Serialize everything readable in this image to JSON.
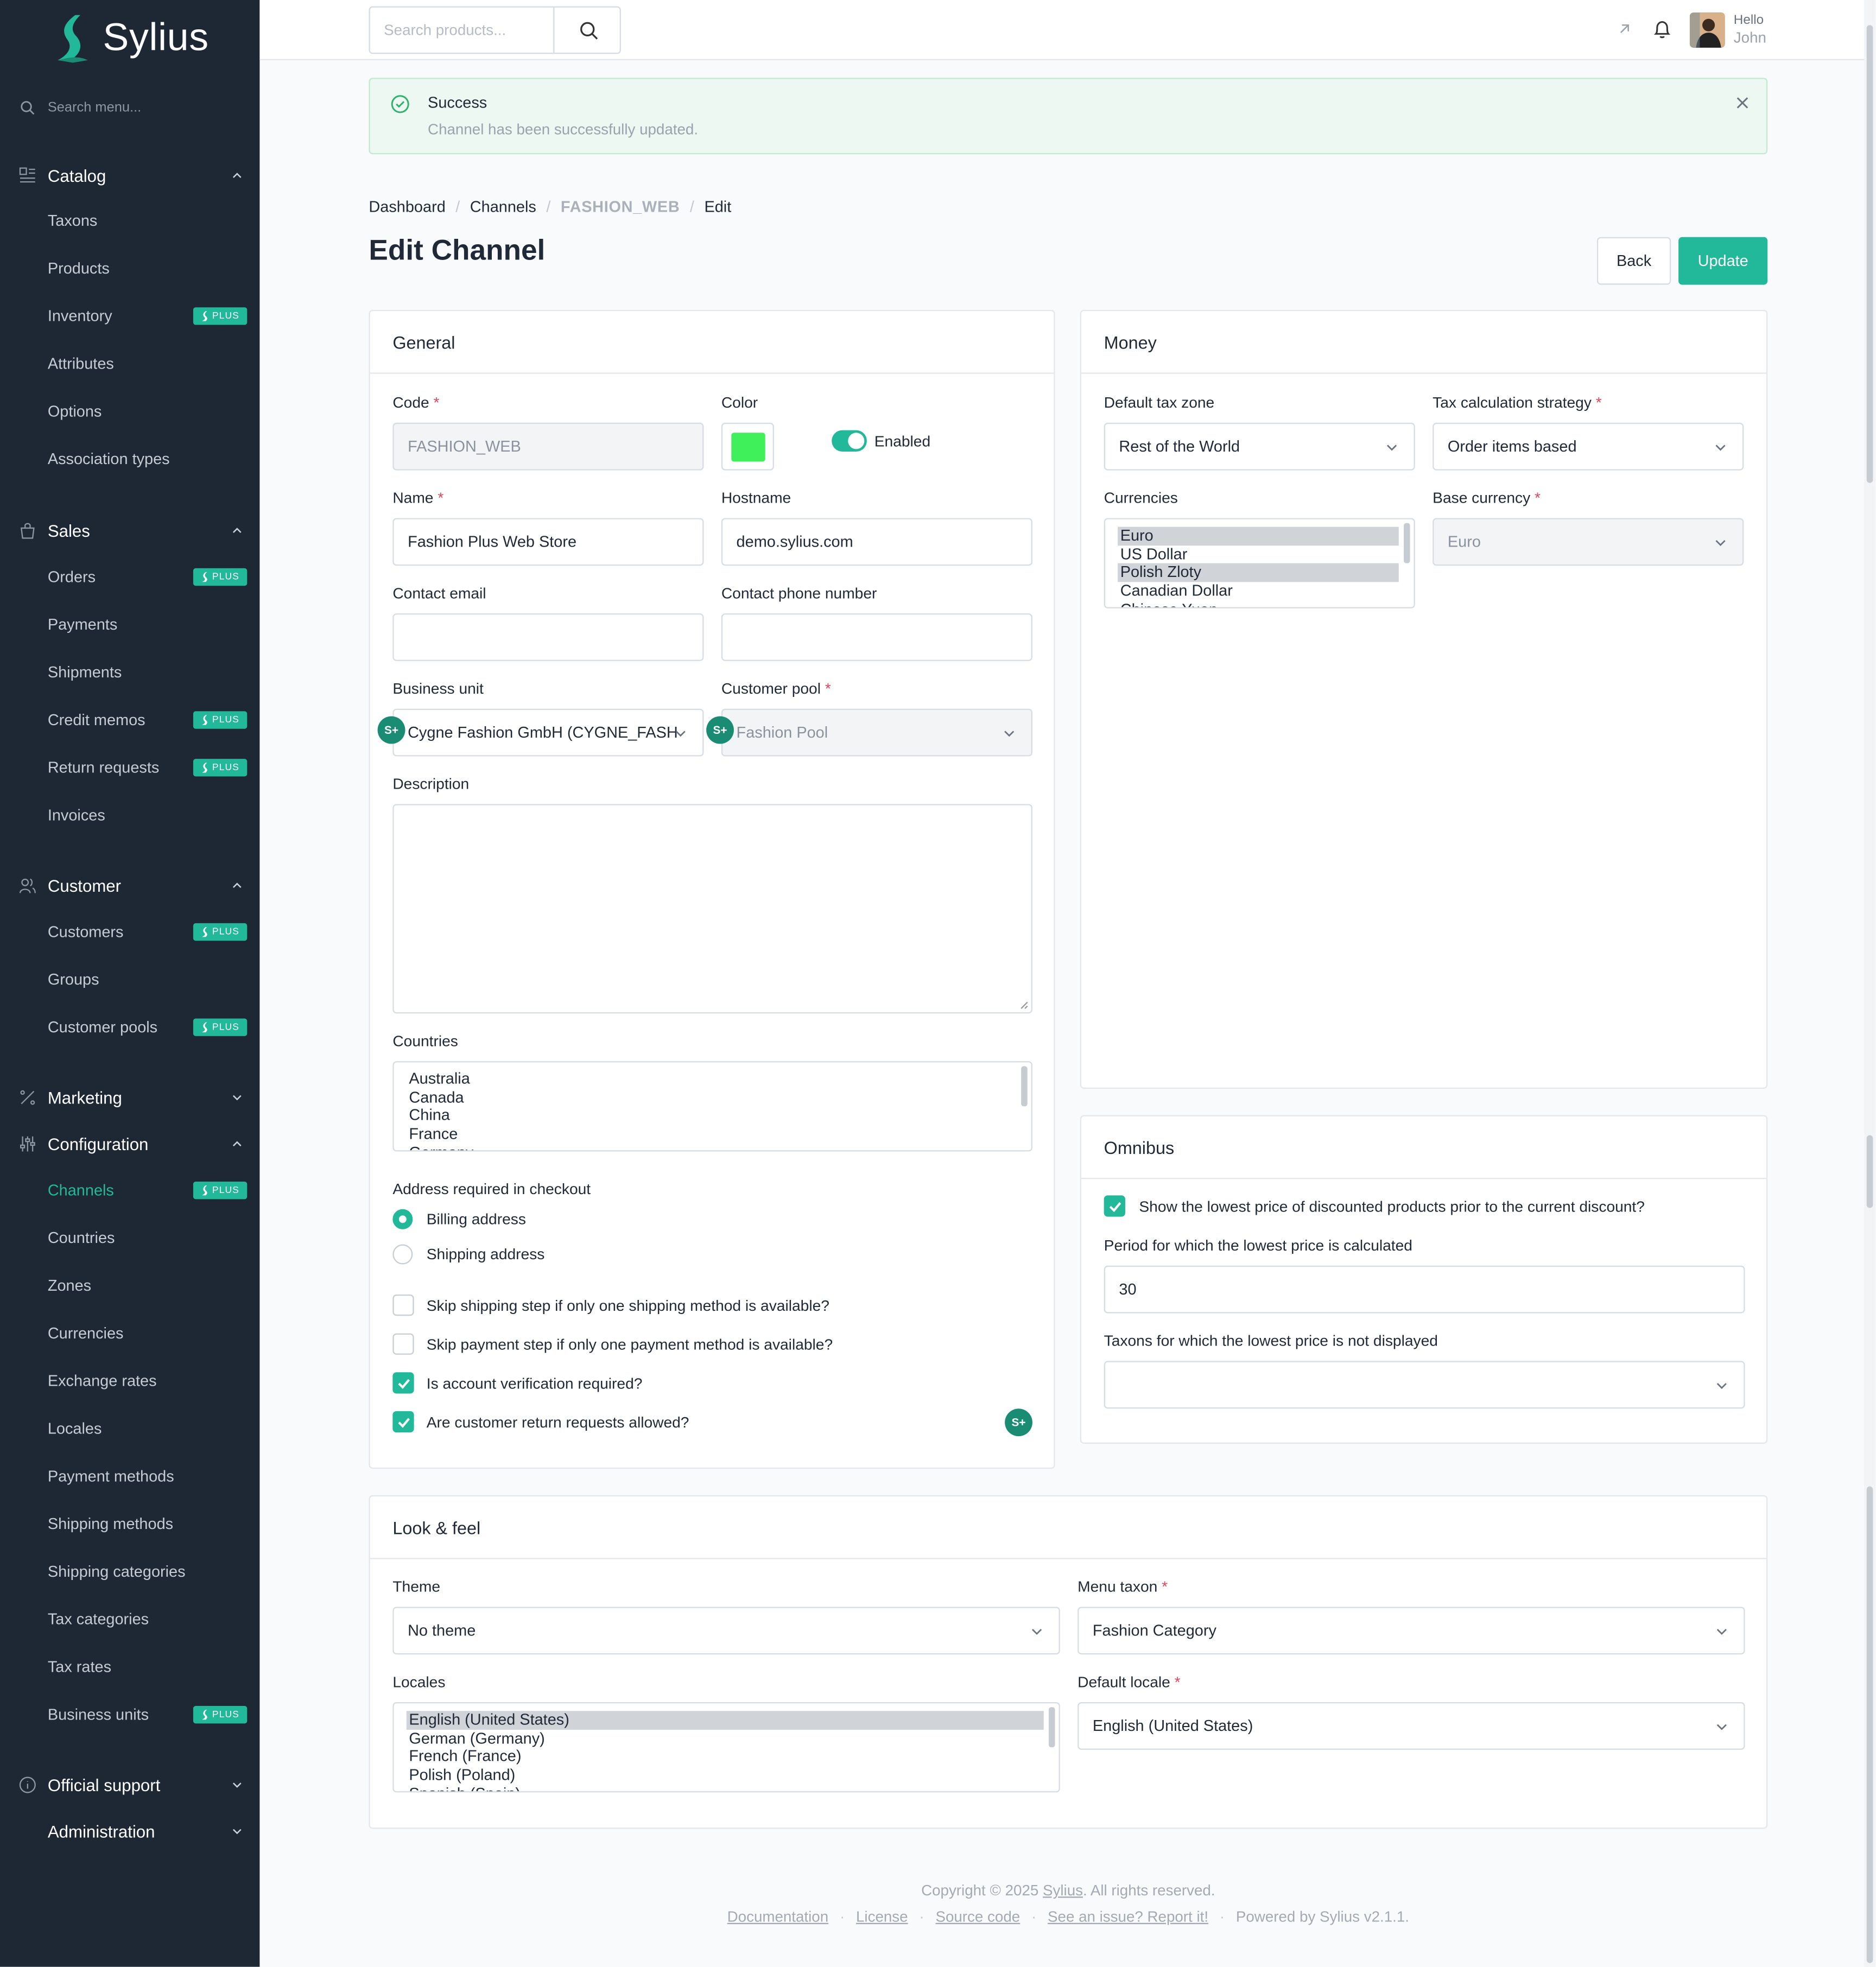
{
  "brand": {
    "name": "Sylius",
    "accent": "#22b99a",
    "sidebar_bg": "#1e2734"
  },
  "sidebar": {
    "search_placeholder": "Search menu...",
    "plus_badge": "PLUS",
    "sections": [
      {
        "label": "Catalog",
        "icon": "catalog-icon",
        "items": [
          {
            "label": "Taxons",
            "plus": false
          },
          {
            "label": "Products",
            "plus": false
          },
          {
            "label": "Inventory",
            "plus": true
          },
          {
            "label": "Attributes",
            "plus": false
          },
          {
            "label": "Options",
            "plus": false
          },
          {
            "label": "Association types",
            "plus": false
          }
        ]
      },
      {
        "label": "Sales",
        "icon": "bag-icon",
        "items": [
          {
            "label": "Orders",
            "plus": true
          },
          {
            "label": "Payments",
            "plus": false
          },
          {
            "label": "Shipments",
            "plus": false
          },
          {
            "label": "Credit memos",
            "plus": true
          },
          {
            "label": "Return requests",
            "plus": true
          },
          {
            "label": "Invoices",
            "plus": false
          }
        ]
      },
      {
        "label": "Customer",
        "icon": "users-icon",
        "items": [
          {
            "label": "Customers",
            "plus": true
          },
          {
            "label": "Groups",
            "plus": false
          },
          {
            "label": "Customer pools",
            "plus": true
          }
        ]
      },
      {
        "label": "Marketing",
        "icon": "percent-icon",
        "items": []
      },
      {
        "label": "Configuration",
        "icon": "sliders-icon",
        "items": [
          {
            "label": "Channels",
            "plus": true,
            "active": true
          },
          {
            "label": "Countries",
            "plus": false
          },
          {
            "label": "Zones",
            "plus": false
          },
          {
            "label": "Currencies",
            "plus": false
          },
          {
            "label": "Exchange rates",
            "plus": false
          },
          {
            "label": "Locales",
            "plus": false
          },
          {
            "label": "Payment methods",
            "plus": false
          },
          {
            "label": "Shipping methods",
            "plus": false
          },
          {
            "label": "Shipping categories",
            "plus": false
          },
          {
            "label": "Tax categories",
            "plus": false
          },
          {
            "label": "Tax rates",
            "plus": false
          },
          {
            "label": "Business units",
            "plus": true
          }
        ]
      },
      {
        "label": "Official support",
        "icon": "info-icon",
        "items": []
      },
      {
        "label": "Administration",
        "icon": "",
        "items": []
      }
    ]
  },
  "topbar": {
    "search_placeholder": "Search products...",
    "greeting": "Hello",
    "user": "John"
  },
  "alert": {
    "title": "Success",
    "message": "Channel has been successfully updated."
  },
  "breadcrumb": [
    "Dashboard",
    "Channels",
    "FASHION_WEB",
    "Edit"
  ],
  "page": {
    "title": "Edit Channel",
    "back": "Back",
    "update": "Update"
  },
  "general": {
    "title": "General",
    "code_label": "Code",
    "code_value": "FASHION_WEB",
    "color_label": "Color",
    "color_value": "#3ff05b",
    "enabled_label": "Enabled",
    "name_label": "Name",
    "name_value": "Fashion Plus Web Store",
    "hostname_label": "Hostname",
    "hostname_value": "demo.sylius.com",
    "email_label": "Contact email",
    "email_value": "",
    "phone_label": "Contact phone number",
    "phone_value": "",
    "bu_label": "Business unit",
    "bu_value": "Cygne Fashion GmbH (CYGNE_FASH",
    "pool_label": "Customer pool",
    "pool_value": "Fashion Pool",
    "description_label": "Description",
    "countries_label": "Countries",
    "countries": [
      "Australia",
      "Canada",
      "China",
      "France",
      "Germany"
    ],
    "address_label": "Address required in checkout",
    "billing": "Billing address",
    "shipping": "Shipping address",
    "checks": [
      {
        "label": "Skip shipping step if only one shipping method is available?",
        "checked": false
      },
      {
        "label": "Skip payment step if only one payment method is available?",
        "checked": false
      },
      {
        "label": "Is account verification required?",
        "checked": true
      },
      {
        "label": "Are customer return requests allowed?",
        "checked": true
      }
    ]
  },
  "money": {
    "title": "Money",
    "tax_zone_label": "Default tax zone",
    "tax_zone": "Rest of the World",
    "strategy_label": "Tax calculation strategy",
    "strategy": "Order items based",
    "currencies_label": "Currencies",
    "currencies": [
      {
        "name": "Euro",
        "selected": true
      },
      {
        "name": "US Dollar",
        "selected": false
      },
      {
        "name": "Polish Zloty",
        "selected": true
      },
      {
        "name": "Canadian Dollar",
        "selected": false
      },
      {
        "name": "Chinese Yuan",
        "selected": false
      }
    ],
    "base_label": "Base currency",
    "base": "Euro"
  },
  "omnibus": {
    "title": "Omnibus",
    "show_label": "Show the lowest price of discounted products prior to the current discount?",
    "period_label": "Period for which the lowest price is calculated",
    "period": "30",
    "taxons_label": "Taxons for which the lowest price is not displayed",
    "taxons": ""
  },
  "look": {
    "title": "Look & feel",
    "theme_label": "Theme",
    "theme": "No theme",
    "menu_label": "Menu taxon",
    "menu": "Fashion Category",
    "locales_label": "Locales",
    "locales": [
      {
        "name": "English (United States)",
        "selected": true
      },
      {
        "name": "German (Germany)",
        "selected": false
      },
      {
        "name": "French (France)",
        "selected": false
      },
      {
        "name": "Polish (Poland)",
        "selected": false
      },
      {
        "name": "Spanish (Spain)",
        "selected": false
      }
    ],
    "default_locale_label": "Default locale",
    "default_locale": "English (United States)"
  },
  "footer": {
    "copyright_pre": "Copyright © 2025 ",
    "copyright_link": "Sylius",
    "copyright_post": ". All rights reserved.",
    "links": [
      "Documentation",
      "License",
      "Source code",
      "See an issue? Report it!"
    ],
    "powered": "Powered by Sylius v2.1.1."
  }
}
